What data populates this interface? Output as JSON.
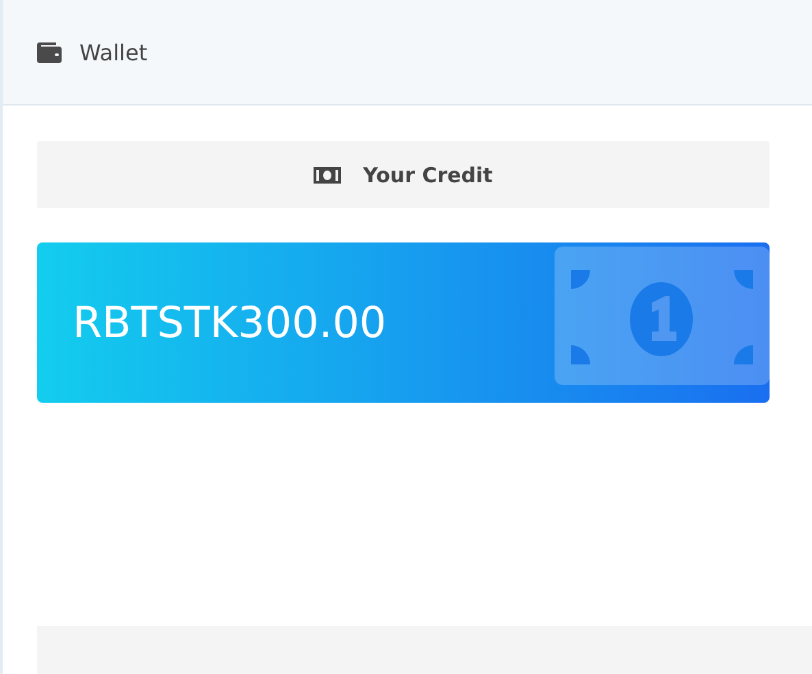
{
  "header": {
    "title": "Wallet"
  },
  "credit": {
    "label": "Your Credit",
    "amount": "RBTSTK300.00"
  }
}
